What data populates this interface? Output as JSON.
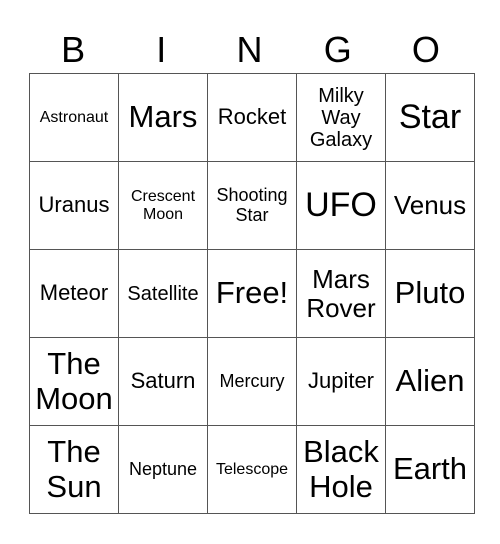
{
  "header": [
    "B",
    "I",
    "N",
    "G",
    "O"
  ],
  "cells": [
    [
      "Astronaut",
      "Mars",
      "Rocket",
      "Milky Way Galaxy",
      "Star"
    ],
    [
      "Uranus",
      "Crescent Moon",
      "Shooting Star",
      "UFO",
      "Venus"
    ],
    [
      "Meteor",
      "Satellite",
      "Free!",
      "Mars Rover",
      "Pluto"
    ],
    [
      "The Moon",
      "Saturn",
      "Mercury",
      "Jupiter",
      "Alien"
    ],
    [
      "The Sun",
      "Neptune",
      "Telescope",
      "Black Hole",
      "Earth"
    ]
  ]
}
